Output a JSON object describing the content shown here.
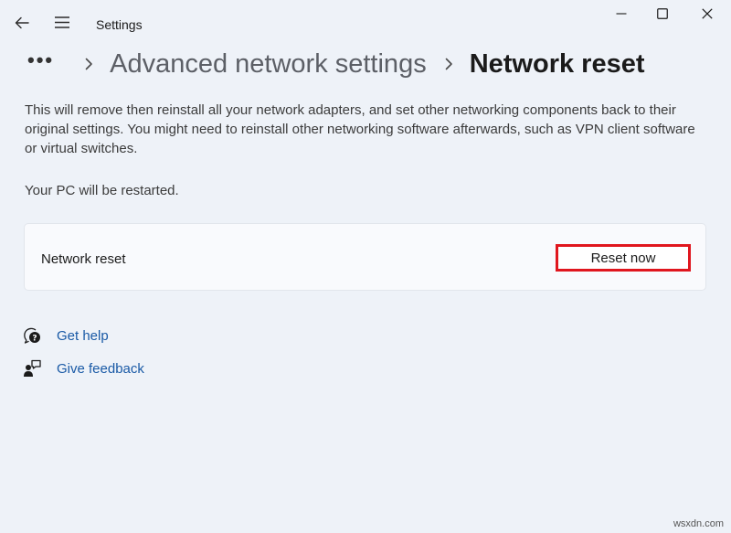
{
  "window": {
    "title": "Settings"
  },
  "breadcrumb": {
    "more": "•••",
    "parent": "Advanced network settings",
    "current": "Network reset"
  },
  "content": {
    "description": "This will remove then reinstall all your network adapters, and set other networking components back to their original settings. You might need to reinstall other networking software afterwards, such as VPN client software or virtual switches.",
    "restart_note": "Your PC will be restarted."
  },
  "card": {
    "label": "Network reset",
    "button_label": "Reset now"
  },
  "links": [
    {
      "label": "Get help",
      "icon": "help-chat-icon"
    },
    {
      "label": "Give feedback",
      "icon": "feedback-icon"
    }
  ],
  "watermark": "wsxdn.com",
  "colors": {
    "background": "#eef2f8",
    "card": "#f9fafd",
    "link": "#1a5aa6",
    "highlight": "#e0161e"
  }
}
